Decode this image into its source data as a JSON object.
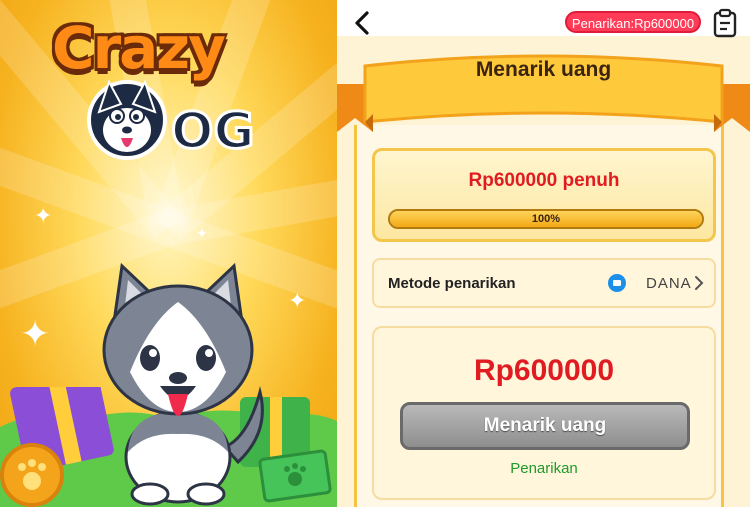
{
  "promo": {
    "logo_line1": "Crazy",
    "logo_line2": "OG",
    "colors": {
      "background": "#f6b21f",
      "logo": "#ff8a15",
      "grass": "#5fc94a",
      "gift": "#8a4fd6"
    }
  },
  "header": {
    "back_icon": "chevron-left-icon",
    "withdraw_pill": "Penarikan:Rp600000",
    "clipboard_icon": "clipboard-icon"
  },
  "banner": {
    "title": "Menarik uang"
  },
  "amount_card": {
    "label": "Rp600000 penuh",
    "progress_percent": 100,
    "progress_text": "100%"
  },
  "method": {
    "label": "Metode penarikan",
    "value": "DANA",
    "icon": "dana-icon"
  },
  "withdraw": {
    "amount": "Rp600000",
    "button_label": "Menarik uang",
    "link_label": "Penarikan"
  },
  "colors": {
    "accent_red": "#e11b22",
    "pill_red": "#ff3b57",
    "ribbon_yellow": "#f6c343",
    "button_gray": "#9e9e9e",
    "link_green": "#1f9a2b"
  }
}
